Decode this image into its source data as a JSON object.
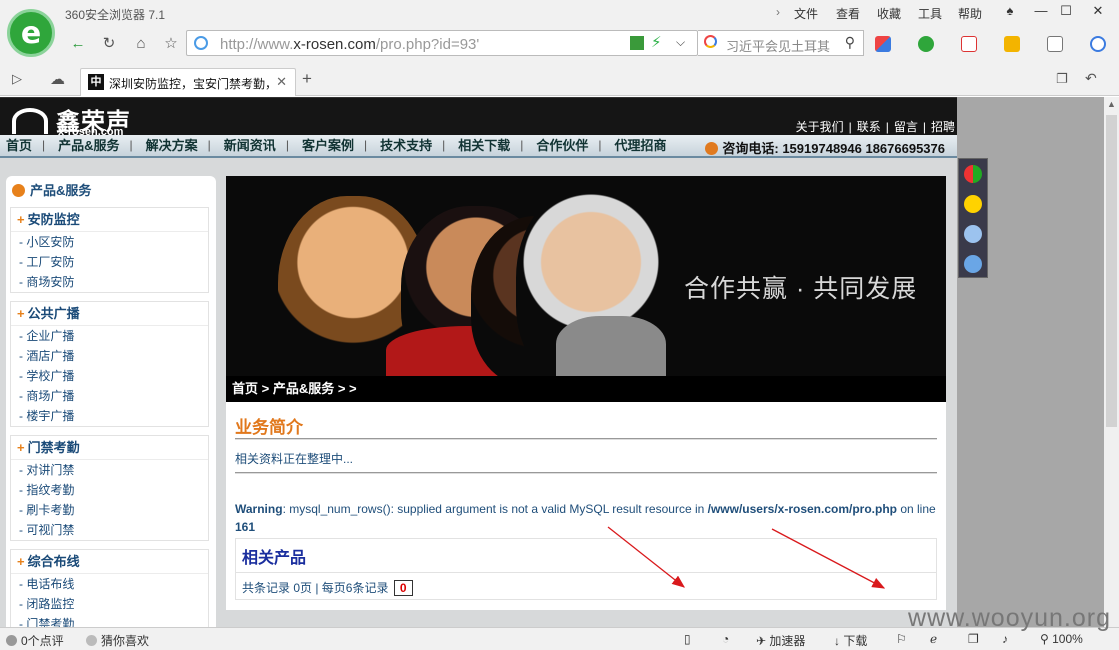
{
  "browser": {
    "title": "360安全浏览器 7.1",
    "menu": [
      "文件",
      "查看",
      "收藏",
      "工具",
      "帮助"
    ],
    "url_prefix": "http://www.",
    "url_domain": "x-rosen.com",
    "url_path": "/pro.php?id=93'",
    "search_text": "习近平会见土耳其",
    "tab_title": "深圳安防监控，宝安门禁考勤，",
    "tab_favicon": "中"
  },
  "site": {
    "logo_cn": "鑫荣声",
    "logo_en": "x-rosen.com",
    "top_links": [
      "关于我们",
      "联系",
      "留言",
      "招聘"
    ],
    "nav": [
      "首页",
      "产品&服务",
      "解决方案",
      "新闻资讯",
      "客户案例",
      "技术支持",
      "相关下载",
      "合作伙伴",
      "代理招商"
    ],
    "hotline_label": "咨询电话:",
    "hotline_numbers": "15919748946 18676695376"
  },
  "sidebar": {
    "title": "产品&服务",
    "categories": [
      {
        "name": "安防监控",
        "items": [
          "小区安防",
          "工厂安防",
          "商场安防"
        ]
      },
      {
        "name": "公共广播",
        "items": [
          "企业广播",
          "酒店广播",
          "学校广播",
          "商场广播",
          "楼宇广播"
        ]
      },
      {
        "name": "门禁考勤",
        "items": [
          "对讲门禁",
          "指纹考勤",
          "刷卡考勤",
          "可视门禁"
        ]
      },
      {
        "name": "综合布线",
        "items": [
          "电话布线",
          "闭路监控",
          "门禁考勤"
        ]
      }
    ]
  },
  "main": {
    "slogan": "合作共赢 · 共同发展",
    "breadcrumb": "首页 > 产品&服务 > >",
    "section_title": "业务简介",
    "section_text": "相关资料正在整理中...",
    "warning_label": "Warning",
    "warning_text": ": mysql_num_rows(): supplied argument is not a valid MySQL result resource in ",
    "warning_path": "/www/users/x-rosen.com/pro.php",
    "warning_on": " on line ",
    "warning_line": "161",
    "related_title": "相关产品",
    "pager_text": "共条记录 0页 | 每页6条记录",
    "pager_current": "0"
  },
  "statusbar": {
    "comments": "0个点评",
    "guess": "猜你喜欢",
    "accelerator": "加速器",
    "download": "下载",
    "zoom": "100%"
  },
  "watermark": "www.wooyun.org",
  "colors": {
    "accent_orange": "#e1781c",
    "link_blue": "#1f4e7a",
    "arrow_red": "#d9191c"
  }
}
